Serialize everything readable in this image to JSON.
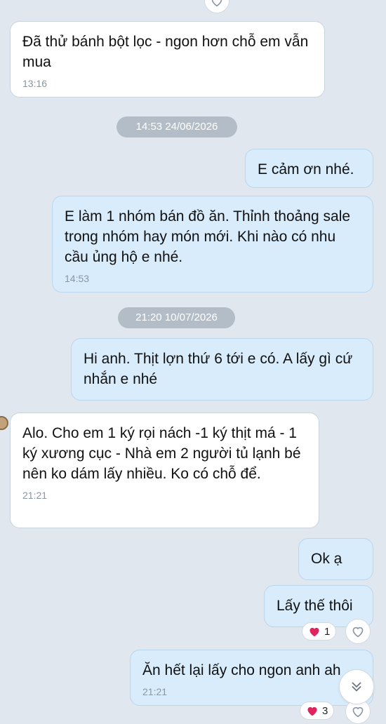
{
  "messages": [
    {
      "text": "Đã thử bánh bột lọc - ngon hơn chỗ em vẫn mua",
      "time": "13:16"
    },
    {
      "text": "E cảm ơn nhé.",
      "time": ""
    },
    {
      "text": "E làm 1 nhóm bán đồ ăn. Thỉnh thoảng sale trong nhóm hay món mới. Khi nào có nhu cầu ủng hộ e nhé.",
      "time": "14:53"
    },
    {
      "text": "Hi anh. Thịt lợn thứ 6 tới e có. A lấy gì cứ nhắn e nhé",
      "time": ""
    },
    {
      "text": "Alo. Cho em 1 ký rọi nách -1 ký thịt má - 1 ký xương cục - Nhà em 2 người tủ lạnh bé nên ko dám lấy nhiều. Ko có chỗ để.",
      "time": "21:21"
    },
    {
      "text": "Ok ạ",
      "time": ""
    },
    {
      "text": "Lấy thế thôi",
      "time": ""
    },
    {
      "text": "Ăn hết lại lấy cho ngon anh ah",
      "time": "21:21"
    }
  ],
  "date_separators": [
    "14:53 24/06/2026",
    "21:20 10/07/2026"
  ],
  "reactions": [
    {
      "emoji": "heart-icon",
      "count": "1"
    },
    {
      "emoji": "heart-icon",
      "count": "3"
    }
  ],
  "colors": {
    "background": "#e1e7ef",
    "incoming_bubble": "#ffffff",
    "outgoing_bubble": "#d8ecfb",
    "heart": "#e0245e",
    "time_text": "#8a96a3"
  }
}
